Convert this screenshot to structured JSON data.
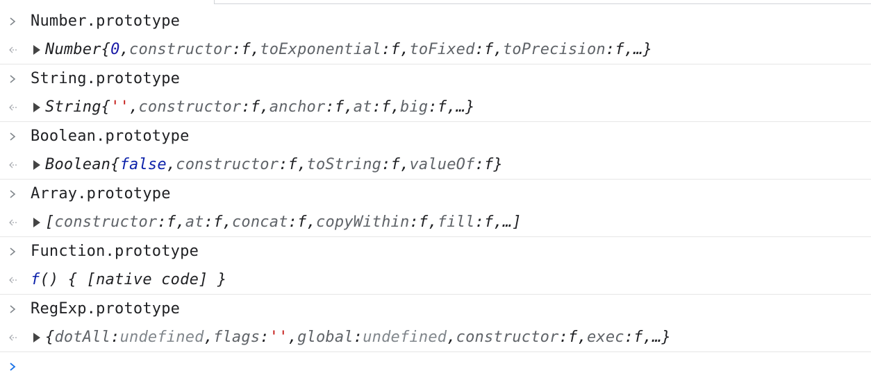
{
  "entries": [
    {
      "input": "Number.prototype",
      "output": {
        "expandable": true,
        "class_name": "Number",
        "primitive": "0",
        "primitive_kind": "num",
        "props": [
          {
            "key": "constructor",
            "val": "f"
          },
          {
            "key": "toExponential",
            "val": "f"
          },
          {
            "key": "toFixed",
            "val": "f"
          },
          {
            "key": "toPrecision",
            "val": "f"
          }
        ],
        "ellipsis": "…",
        "open": "{",
        "close": "}"
      }
    },
    {
      "input": "String.prototype",
      "output": {
        "expandable": true,
        "class_name": "String",
        "primitive": "''",
        "primitive_kind": "str",
        "props": [
          {
            "key": "constructor",
            "val": "f"
          },
          {
            "key": "anchor",
            "val": "f"
          },
          {
            "key": "at",
            "val": "f"
          },
          {
            "key": "big",
            "val": "f"
          }
        ],
        "ellipsis": "…",
        "open": "{",
        "close": "}"
      }
    },
    {
      "input": "Boolean.prototype",
      "output": {
        "expandable": true,
        "class_name": "Boolean",
        "primitive": "false",
        "primitive_kind": "kw",
        "props": [
          {
            "key": "constructor",
            "val": "f"
          },
          {
            "key": "toString",
            "val": "f"
          },
          {
            "key": "valueOf",
            "val": "f"
          }
        ],
        "ellipsis": "",
        "open": "{",
        "close": "}"
      }
    },
    {
      "input": "Array.prototype",
      "output": {
        "expandable": true,
        "class_name": "",
        "primitive": "",
        "primitive_kind": "",
        "props": [
          {
            "key": "constructor",
            "val": "f"
          },
          {
            "key": "at",
            "val": "f"
          },
          {
            "key": "concat",
            "val": "f"
          },
          {
            "key": "copyWithin",
            "val": "f"
          },
          {
            "key": "fill",
            "val": "f"
          }
        ],
        "ellipsis": "…",
        "open": "[",
        "close": "]"
      }
    },
    {
      "input": "Function.prototype",
      "output_text": {
        "f": "f",
        "rest": " () { [native code] }"
      }
    },
    {
      "input": "RegExp.prototype",
      "output": {
        "expandable": true,
        "class_name": "",
        "primitive": "",
        "primitive_kind": "",
        "props": [
          {
            "key": "dotAll",
            "val": "undefined",
            "kind": "un"
          },
          {
            "key": "flags",
            "val": "''",
            "kind": "str"
          },
          {
            "key": "global",
            "val": "undefined",
            "kind": "un"
          },
          {
            "key": "constructor",
            "val": "f"
          },
          {
            "key": "exec",
            "val": "f"
          }
        ],
        "ellipsis": "…",
        "open": "{",
        "close": "}"
      }
    }
  ],
  "colors": {
    "prompt": "#80868b",
    "active_prompt": "#1a73e8",
    "number": "#1a1aa6",
    "string": "#c41a16",
    "keyword": "#0d22aa",
    "muted": "#80868b"
  },
  "icons": {
    "input_prompt": "chevron-right-icon",
    "output_marker": "return-arrow-icon",
    "expand": "triangle-right-icon"
  }
}
